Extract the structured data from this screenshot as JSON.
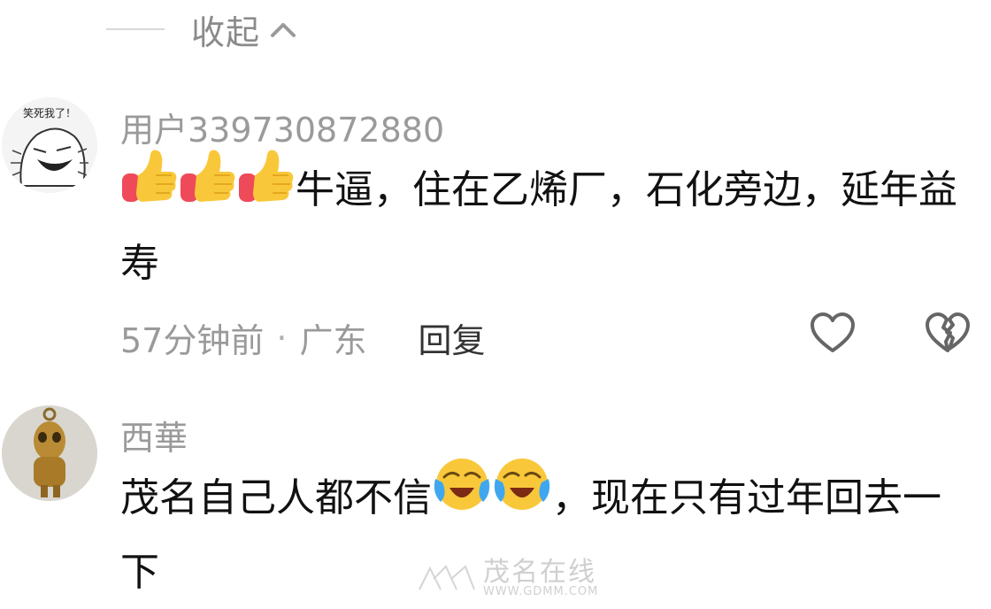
{
  "collapse": {
    "label": "收起"
  },
  "comments": [
    {
      "avatar_text": "笑死我了！",
      "username": "用户339730872880",
      "text_parts": [
        "牛逼，住在乙烯厂，石化旁边，延年益寿"
      ],
      "emoji_prefix": [
        "thumbs-up-icon",
        "thumbs-up-icon",
        "thumbs-up-icon"
      ],
      "time": "57分钟前",
      "separator": "·",
      "location": "广东",
      "reply_label": "回复"
    },
    {
      "username": "西華",
      "text_before": "茂名自己人都不信",
      "emoji_middle": [
        "laughing-crying-icon",
        "laughing-crying-icon"
      ],
      "text_after": "，现在只有过年回去一下"
    }
  ],
  "watermark": {
    "brand": "茂名在线",
    "url": "WWW.GDMM.COM"
  },
  "colors": {
    "meta_gray": "#9a9a9a",
    "text": "#111111",
    "thumb_yellow": "#f9c83a",
    "cuff_red": "#ef4a5a"
  }
}
